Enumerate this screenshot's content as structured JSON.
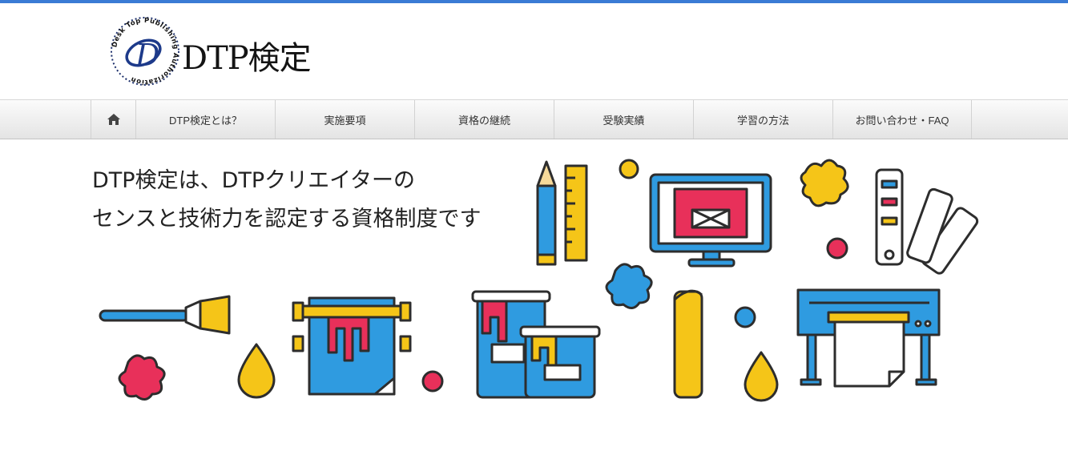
{
  "header": {
    "logo_text": "DTP検定",
    "logo_ring_text": "Desk Top Publishing Authorization",
    "logo_letter": "D"
  },
  "nav": {
    "home_icon": "home-icon",
    "items": [
      {
        "label": "DTP検定とは？"
      },
      {
        "label": "実施要項"
      },
      {
        "label": "資格の継続"
      },
      {
        "label": "受験実績"
      },
      {
        "label": "学習の方法"
      },
      {
        "label": "お問い合わせ・FAQ"
      }
    ]
  },
  "hero": {
    "line1": "DTP検定は、DTPクリエイターの",
    "line2": "センスと技術力を認定する資格制度です"
  },
  "colors": {
    "accent": "#3a7bd5",
    "blue": "#2f9be0",
    "yellow": "#f5c518",
    "red": "#e8305a",
    "outline": "#2d2d2d"
  }
}
